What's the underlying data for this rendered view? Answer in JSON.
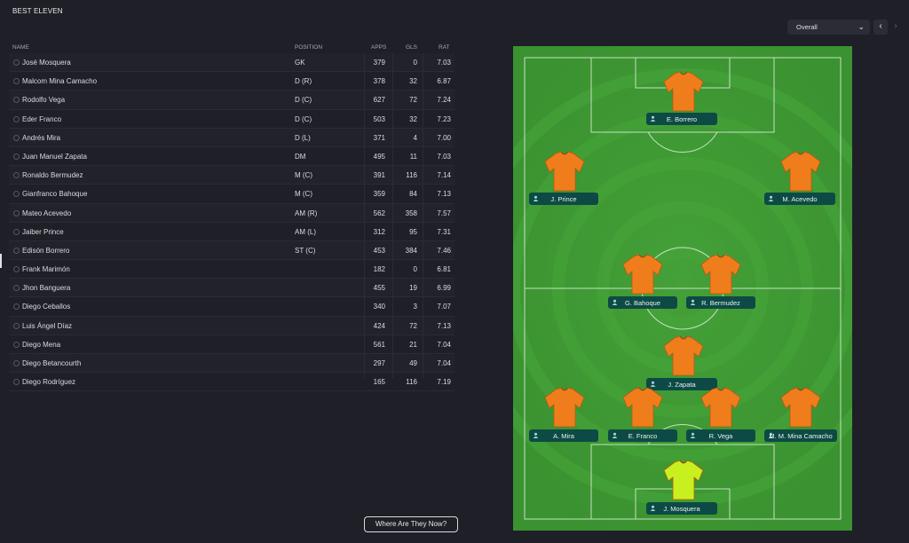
{
  "header": {
    "title": "BEST ELEVEN"
  },
  "columns": {
    "name": "NAME",
    "position": "POSITION",
    "apps": "APPS",
    "gls": "GLS",
    "rat": "RAT"
  },
  "players": [
    {
      "name": "José Mosquera",
      "position": "GK",
      "apps": "379",
      "gls": "0",
      "rat": "7.03"
    },
    {
      "name": "Malcom Mina Camacho",
      "position": "D (R)",
      "apps": "378",
      "gls": "32",
      "rat": "6.87"
    },
    {
      "name": "Rodolfo Vega",
      "position": "D (C)",
      "apps": "627",
      "gls": "72",
      "rat": "7.24"
    },
    {
      "name": "Eder Franco",
      "position": "D (C)",
      "apps": "503",
      "gls": "32",
      "rat": "7.23"
    },
    {
      "name": "Andrés Mira",
      "position": "D (L)",
      "apps": "371",
      "gls": "4",
      "rat": "7.00"
    },
    {
      "name": "Juan Manuel Zapata",
      "position": "DM",
      "apps": "495",
      "gls": "11",
      "rat": "7.03"
    },
    {
      "name": "Ronaldo Bermudez",
      "position": "M (C)",
      "apps": "391",
      "gls": "116",
      "rat": "7.14"
    },
    {
      "name": "Gianfranco Bahoque",
      "position": "M (C)",
      "apps": "359",
      "gls": "84",
      "rat": "7.13"
    },
    {
      "name": "Mateo Acevedo",
      "position": "AM (R)",
      "apps": "562",
      "gls": "358",
      "rat": "7.57"
    },
    {
      "name": "Jaiber Prince",
      "position": "AM (L)",
      "apps": "312",
      "gls": "95",
      "rat": "7.31"
    },
    {
      "name": "Edisón Borrero",
      "position": "ST (C)",
      "apps": "453",
      "gls": "384",
      "rat": "7.46"
    },
    {
      "name": "Frank Marimón",
      "position": "",
      "apps": "182",
      "gls": "0",
      "rat": "6.81"
    },
    {
      "name": "Jhon Banguera",
      "position": "",
      "apps": "455",
      "gls": "19",
      "rat": "6.99"
    },
    {
      "name": "Diego Ceballos",
      "position": "",
      "apps": "340",
      "gls": "3",
      "rat": "7.07"
    },
    {
      "name": "Luis Ángel Díaz",
      "position": "",
      "apps": "424",
      "gls": "72",
      "rat": "7.13"
    },
    {
      "name": "Diego Mena",
      "position": "",
      "apps": "561",
      "gls": "21",
      "rat": "7.04"
    },
    {
      "name": "Diego Betancourth",
      "position": "",
      "apps": "297",
      "gls": "49",
      "rat": "7.04"
    },
    {
      "name": "Diego Rodríguez",
      "position": "",
      "apps": "165",
      "gls": "116",
      "rat": "7.19"
    }
  ],
  "filter": {
    "selected": "Overall",
    "prev": "‹",
    "next": "›"
  },
  "pitch_players": [
    {
      "label": "E. Borrero",
      "kit": "outfield"
    },
    {
      "label": "J. Prince",
      "kit": "outfield"
    },
    {
      "label": "M. Acevedo",
      "kit": "outfield"
    },
    {
      "label": "G. Bahoque",
      "kit": "outfield"
    },
    {
      "label": "R. Bermudez",
      "kit": "outfield"
    },
    {
      "label": "J. Zapata",
      "kit": "outfield"
    },
    {
      "label": "A. Mira",
      "kit": "outfield"
    },
    {
      "label": "E. Franco",
      "kit": "outfield"
    },
    {
      "label": "R. Vega",
      "kit": "outfield"
    },
    {
      "label": "M.  M. Mina Camacho",
      "kit": "outfield"
    },
    {
      "label": "J. Mosquera",
      "kit": "goalkeeper"
    }
  ],
  "footer": {
    "where_label": "Where Are They Now?"
  },
  "colors": {
    "pitch": "#3f9a33",
    "shirt": "#f07d1c",
    "gk_shirt": "#c8f01e",
    "badge": "#0d4a45",
    "background": "#1e1f27"
  }
}
